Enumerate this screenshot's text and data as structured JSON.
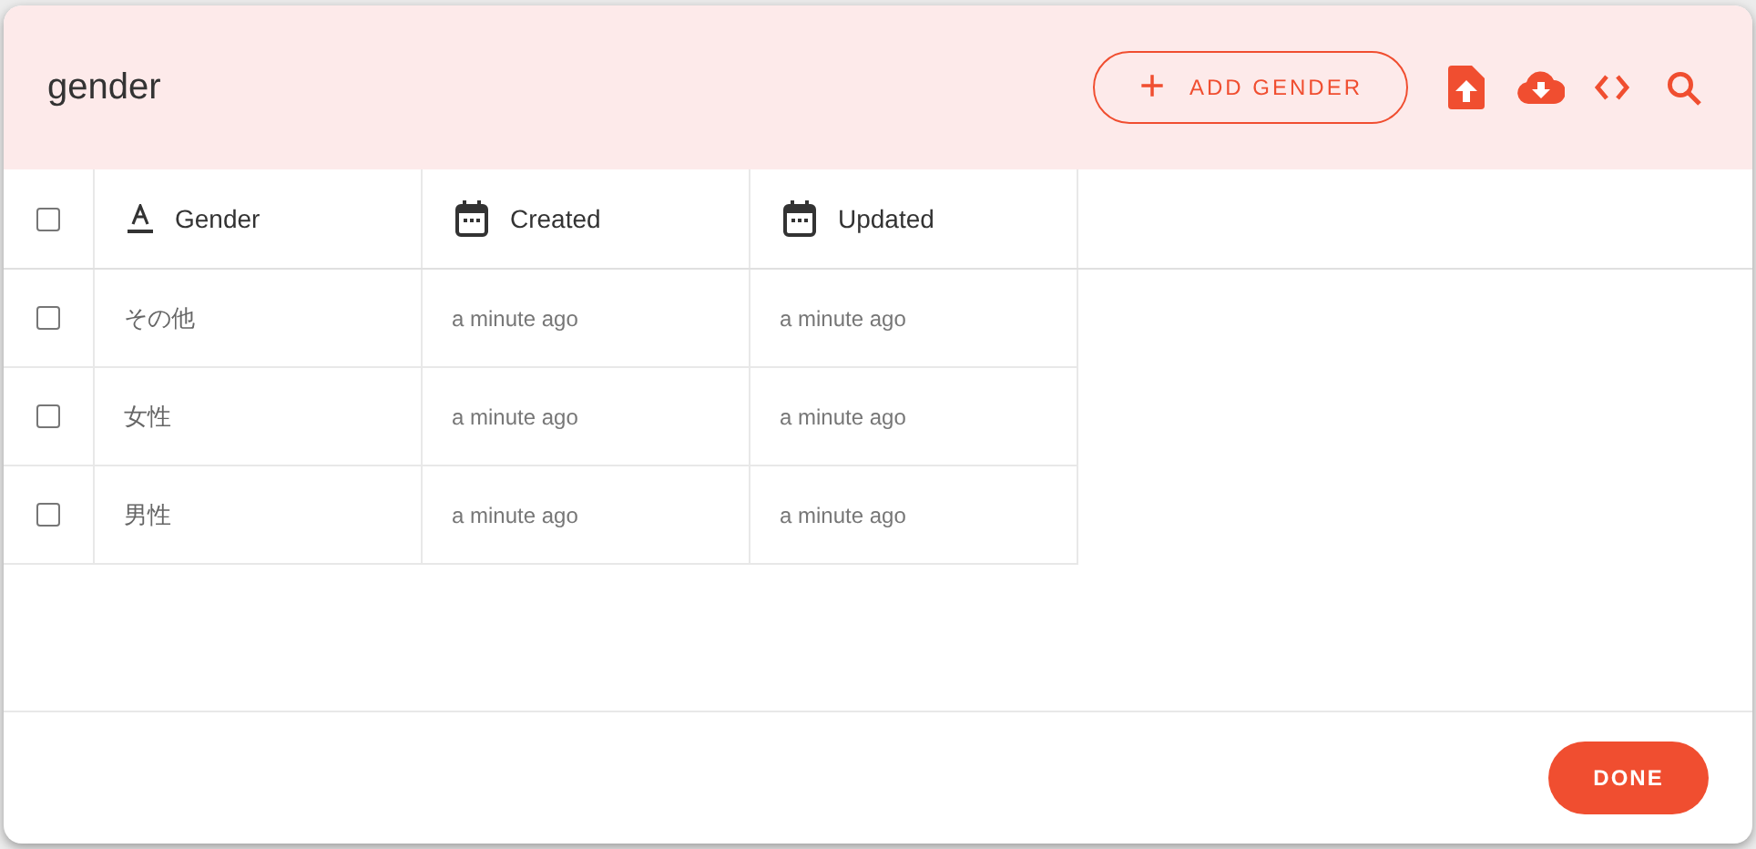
{
  "dialog": {
    "title": "gender",
    "toolbar": {
      "add_button": "ADD GENDER",
      "plus_icon": "+"
    },
    "table": {
      "columns": [
        {
          "kind": "select",
          "checked": false
        },
        {
          "kind": "text",
          "label": "Gender"
        },
        {
          "kind": "date",
          "label": "Created"
        },
        {
          "kind": "date",
          "label": "Updated"
        }
      ],
      "rows": [
        {
          "checked": false,
          "gender": "その他",
          "created": "a minute ago",
          "updated": "a minute ago"
        },
        {
          "checked": false,
          "gender": "女性",
          "created": "a minute ago",
          "updated": "a minute ago"
        },
        {
          "checked": false,
          "gender": "男性",
          "created": "a minute ago",
          "updated": "a minute ago"
        }
      ]
    },
    "done_button": "DONE"
  }
}
